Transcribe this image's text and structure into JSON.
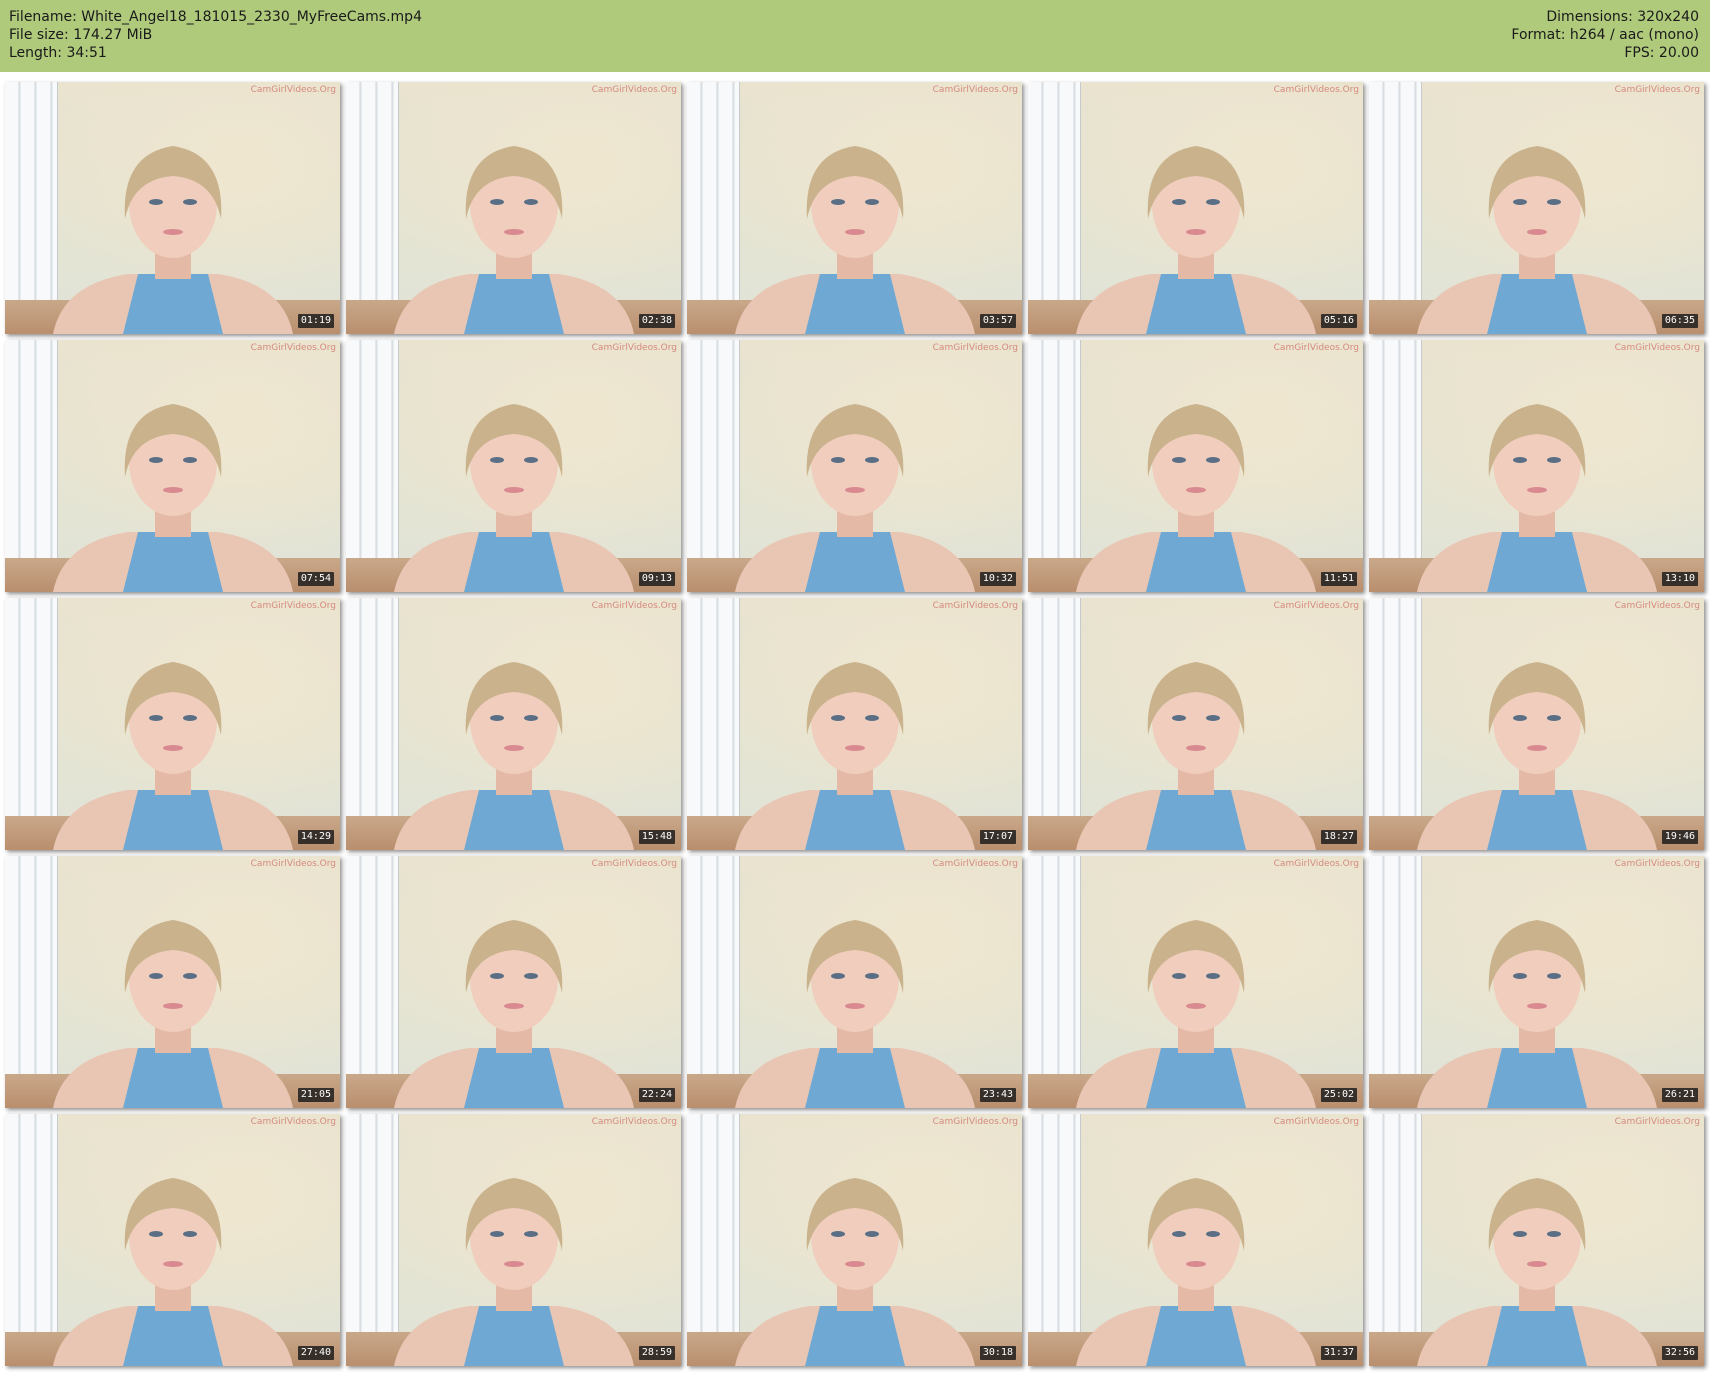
{
  "header": {
    "filename": "Filename: White_Angel18_181015_2330_MyFreeCams.mp4",
    "filesize": "File size: 174.27 MiB",
    "length": "Length: 34:51",
    "dimensions": "Dimensions: 320x240",
    "format": "Format: h264 / aac (mono)",
    "fps": "FPS: 20.00"
  },
  "thumbnails": [
    {
      "time": "01:19",
      "watermark": "CamGirlVideos.Org"
    },
    {
      "time": "02:38",
      "watermark": "CamGirlVideos.Org"
    },
    {
      "time": "03:57",
      "watermark": "CamGirlVideos.Org"
    },
    {
      "time": "05:16",
      "watermark": "CamGirlVideos.Org"
    },
    {
      "time": "06:35",
      "watermark": "CamGirlVideos.Org"
    },
    {
      "time": "07:54",
      "watermark": "CamGirlVideos.Org"
    },
    {
      "time": "09:13",
      "watermark": "CamGirlVideos.Org"
    },
    {
      "time": "10:32",
      "watermark": "CamGirlVideos.Org"
    },
    {
      "time": "11:51",
      "watermark": "CamGirlVideos.Org"
    },
    {
      "time": "13:10",
      "watermark": "CamGirlVideos.Org"
    },
    {
      "time": "14:29",
      "watermark": "CamGirlVideos.Org"
    },
    {
      "time": "15:48",
      "watermark": "CamGirlVideos.Org"
    },
    {
      "time": "17:07",
      "watermark": "CamGirlVideos.Org"
    },
    {
      "time": "18:27",
      "watermark": "CamGirlVideos.Org"
    },
    {
      "time": "19:46",
      "watermark": "CamGirlVideos.Org"
    },
    {
      "time": "21:05",
      "watermark": "CamGirlVideos.Org"
    },
    {
      "time": "22:24",
      "watermark": "CamGirlVideos.Org"
    },
    {
      "time": "23:43",
      "watermark": "CamGirlVideos.Org"
    },
    {
      "time": "25:02",
      "watermark": "CamGirlVideos.Org"
    },
    {
      "time": "26:21",
      "watermark": "CamGirlVideos.Org"
    },
    {
      "time": "27:40",
      "watermark": "CamGirlVideos.Org"
    },
    {
      "time": "28:59",
      "watermark": "CamGirlVideos.Org"
    },
    {
      "time": "30:18",
      "watermark": "CamGirlVideos.Org"
    },
    {
      "time": "31:37",
      "watermark": "CamGirlVideos.Org"
    },
    {
      "time": "32:56",
      "watermark": "CamGirlVideos.Org"
    }
  ]
}
